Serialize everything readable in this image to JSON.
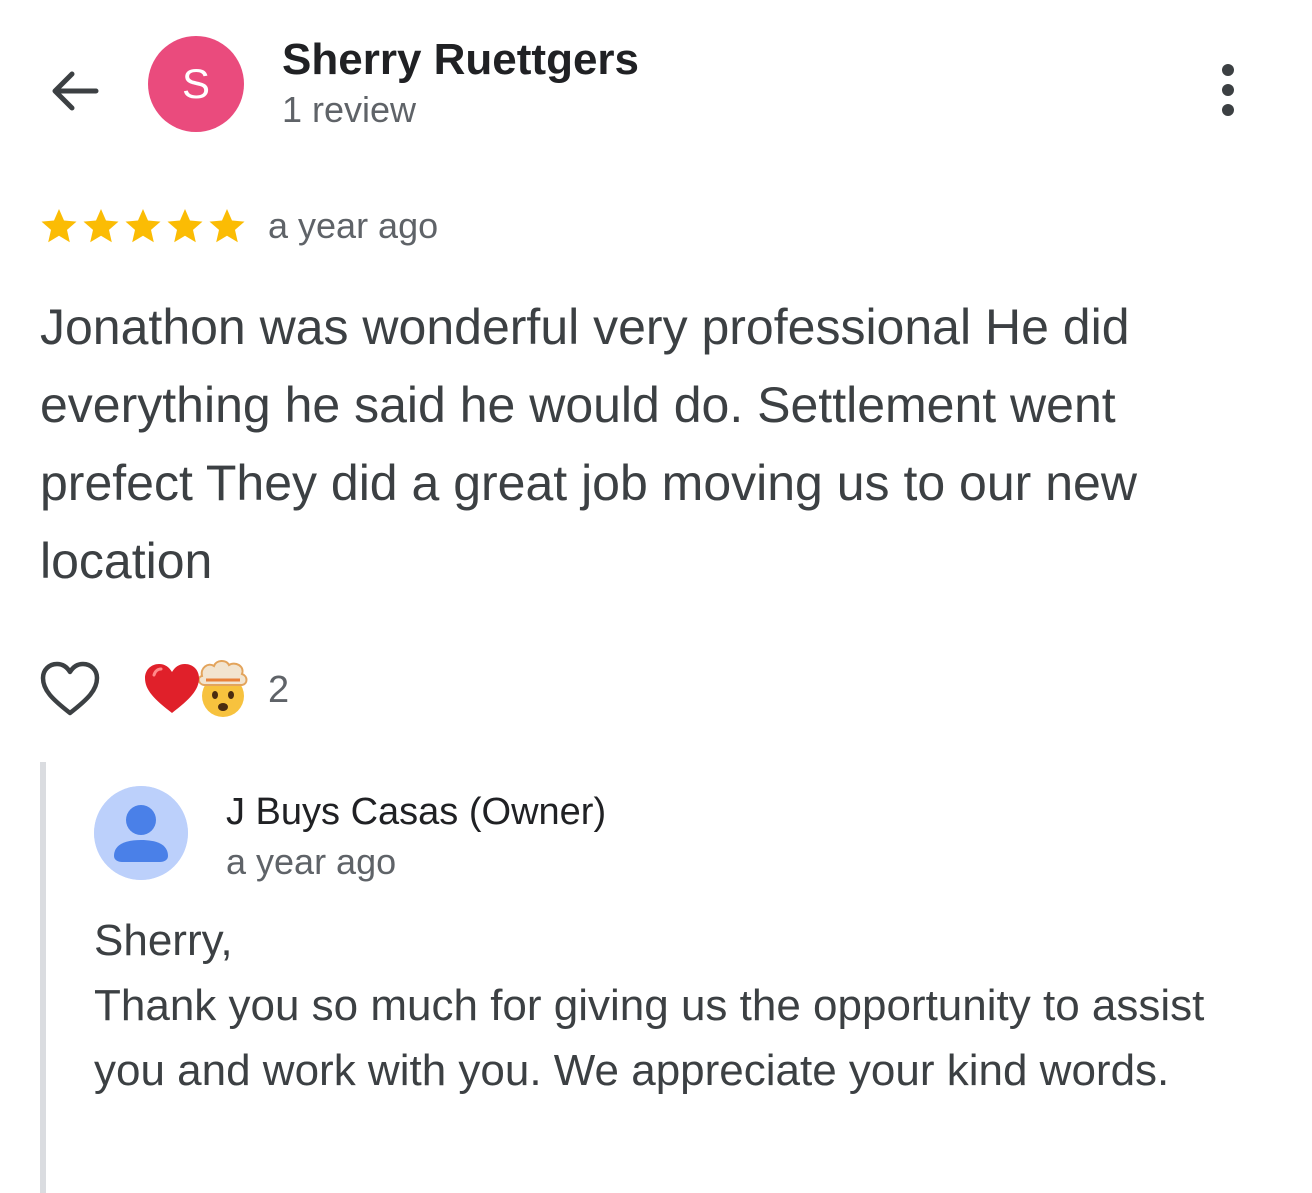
{
  "header": {
    "back_icon": "arrow-left-icon",
    "avatar_initial": "S",
    "avatar_color": "#ea4b7d",
    "reviewer_name": "Sherry Ruettgers",
    "review_count": "1 review",
    "more_icon": "more-vertical-icon"
  },
  "review": {
    "rating": 5,
    "rating_max": 5,
    "star_color": "#fbbc04",
    "time": "a year ago",
    "text": "Jonathon was wonderful very professional He did everything he said he would do. Settlement went prefect They did a great job moving us to our new location"
  },
  "reactions": {
    "like_icon": "heart-outline-icon",
    "emojis": [
      "❤️",
      "🤯"
    ],
    "count": "2"
  },
  "owner_reply": {
    "name": "J Buys Casas (Owner)",
    "time": "a year ago",
    "avatar_icon": "default-person-avatar-icon",
    "avatar_color": "#bcd0fb",
    "greeting": "Sherry,",
    "body": "Thank you so much for giving us the opportunity to assist you and work with you. We appreciate your kind words."
  }
}
